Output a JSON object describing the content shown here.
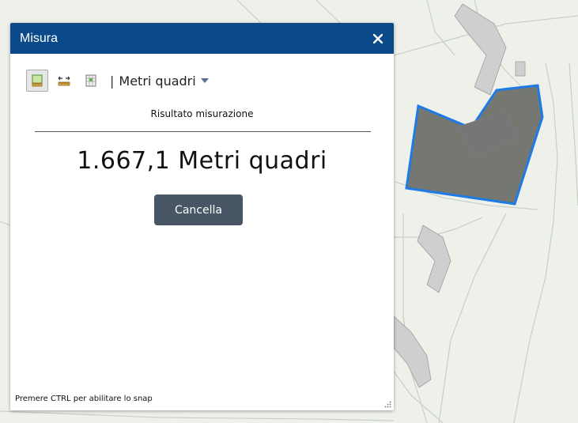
{
  "colors": {
    "map_background": "#eef1ea",
    "road_line": "#c9cec4",
    "building_hatch": "#b6b6b6",
    "polygon_fill": "#666a64",
    "polygon_stroke": "#1e7ae6",
    "header": "#0b4a8a",
    "button": "#475565"
  },
  "panel": {
    "title": "Misura",
    "close_icon": "close-icon"
  },
  "toolbar": {
    "tools": [
      {
        "icon": "area-measure-icon",
        "active": true
      },
      {
        "icon": "distance-measure-icon",
        "active": false
      },
      {
        "icon": "location-measure-icon",
        "active": false
      }
    ],
    "separator": "|",
    "unit_selected": "Metri quadri"
  },
  "result": {
    "label": "Risultato misurazione",
    "value": "1.667,1 Metri quadri"
  },
  "clear_button": "Cancella",
  "footer": {
    "hint": "Premere CTRL per abilitare lo snap"
  }
}
